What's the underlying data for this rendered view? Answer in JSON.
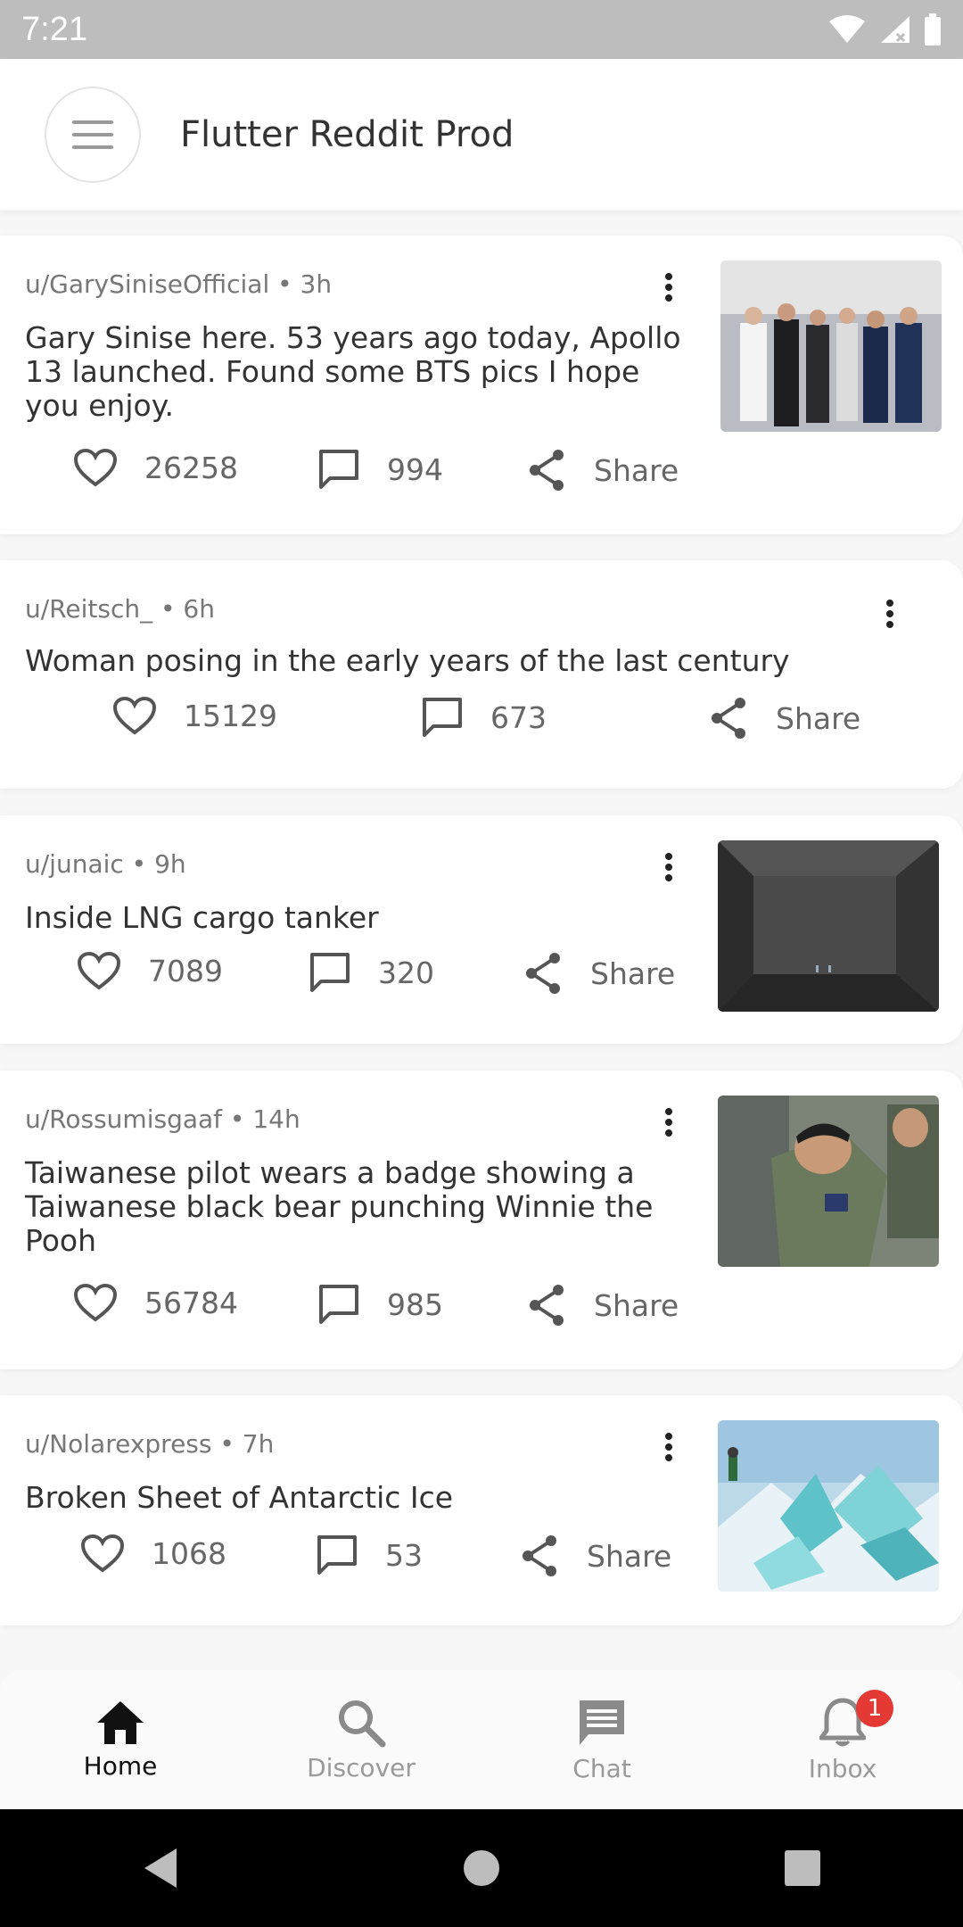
{
  "status": {
    "time": "7:21"
  },
  "app_bar": {
    "title": "Flutter Reddit Prod"
  },
  "posts": [
    {
      "author": "u/GarySiniseOfficial • 3h",
      "title": "Gary Sinise here. 53 years ago today, Apollo 13 launched. Found some BTS pics I hope you enjoy.",
      "likes": "26258",
      "comments": "994",
      "share": "Share",
      "has_thumb": true
    },
    {
      "author": "u/Reitsch_ • 6h",
      "title": "Woman posing in the early years of the last century",
      "likes": "15129",
      "comments": "673",
      "share": "Share",
      "has_thumb": false
    },
    {
      "author": "u/junaic • 9h",
      "title": "Inside LNG cargo tanker",
      "likes": "7089",
      "comments": "320",
      "share": "Share",
      "has_thumb": true
    },
    {
      "author": "u/Rossumisgaaf • 14h",
      "title": "Taiwanese pilot wears a badge showing a Taiwanese black bear punching Winnie the Pooh",
      "likes": "56784",
      "comments": "985",
      "share": "Share",
      "has_thumb": true
    },
    {
      "author": "u/Nolarexpress • 7h",
      "title": "Broken Sheet of Antarctic Ice",
      "likes": "1068",
      "comments": "53",
      "share": "Share",
      "has_thumb": true
    }
  ],
  "bottom_nav": {
    "items": [
      {
        "label": "Home",
        "icon": "home-icon",
        "active": true
      },
      {
        "label": "Discover",
        "icon": "search-icon",
        "active": false
      },
      {
        "label": "Chat",
        "icon": "chat-icon",
        "active": false
      },
      {
        "label": "Inbox",
        "icon": "bell-icon",
        "active": false
      }
    ],
    "inbox_badge": "1"
  },
  "colors": {
    "badge": "#e53935",
    "status_bar": "#bdbdbd"
  }
}
